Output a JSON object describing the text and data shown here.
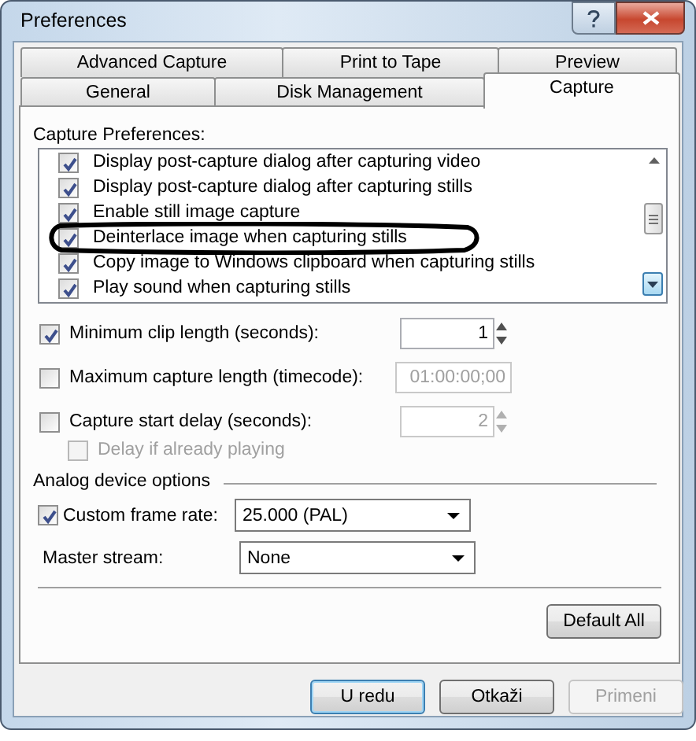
{
  "window": {
    "title": "Preferences"
  },
  "tabs": [
    [
      {
        "label": "Advanced Capture",
        "selected": false
      },
      {
        "label": "Print to Tape",
        "selected": false
      },
      {
        "label": "Preview",
        "selected": false
      }
    ],
    [
      {
        "label": "General",
        "selected": false
      },
      {
        "label": "Disk Management",
        "selected": false
      },
      {
        "label": "Capture",
        "selected": true
      }
    ]
  ],
  "capture_preferences": {
    "label": "Capture Preferences:",
    "items": [
      {
        "label": "Display post-capture dialog after capturing video",
        "checked": true
      },
      {
        "label": "Display post-capture dialog after capturing stills",
        "checked": true
      },
      {
        "label": "Enable still image capture",
        "checked": true
      },
      {
        "label": "Deinterlace image when capturing stills",
        "checked": true
      },
      {
        "label": "Copy image to Windows clipboard when capturing stills",
        "checked": true
      },
      {
        "label": "Play sound when capturing stills",
        "checked": true
      }
    ]
  },
  "options": [
    {
      "kind": "spinner",
      "label": "Minimum clip length (seconds):",
      "checked": true,
      "disabled": false,
      "value": "1"
    },
    {
      "kind": "text",
      "label": "Maximum capture length (timecode):",
      "checked": false,
      "disabled": true,
      "value": "01:00:00;00"
    },
    {
      "kind": "spinner",
      "label": "Capture start delay (seconds):",
      "checked": false,
      "disabled": true,
      "value": "2",
      "children": [
        {
          "kind": "plain",
          "label": "Delay if already playing",
          "checked": false,
          "disabled": true
        }
      ]
    }
  ],
  "analog": {
    "label": "Analog device options",
    "rows": [
      {
        "kind": "check",
        "label": "Custom frame rate:",
        "checked": true,
        "value": "25.000 (PAL)"
      },
      {
        "kind": "plain",
        "label": "Master stream:",
        "value": "None"
      }
    ]
  },
  "default_button": {
    "label": "Default All"
  },
  "buttons": [
    {
      "label": "U redu",
      "default": true,
      "disabled": false
    },
    {
      "label": "Otkaži",
      "default": false,
      "disabled": false
    },
    {
      "label": "Primeni",
      "default": false,
      "disabled": true
    }
  ]
}
